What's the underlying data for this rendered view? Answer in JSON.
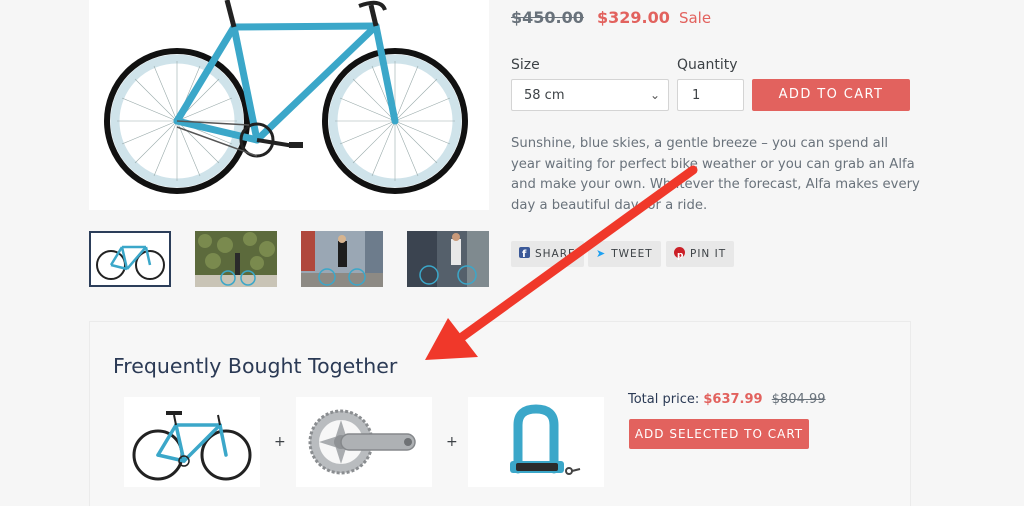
{
  "product": {
    "price_old": "$450.00",
    "price_new": "$329.00",
    "sale_label": "Sale"
  },
  "options": {
    "size_label": "Size",
    "size_value": "58 cm",
    "quantity_label": "Quantity",
    "quantity_value": "1",
    "add_to_cart": "ADD TO CART"
  },
  "description": "Sunshine, blue skies, a gentle breeze – you can spend all year waiting for perfect bike weather or you can grab an Alfa and make your own. Whatever the forecast, Alfa makes every day a beautiful day for a ride.",
  "share": {
    "facebook": "SHARE",
    "twitter": "TWEET",
    "pinterest": "PIN IT"
  },
  "fbt": {
    "title": "Frequently Bought Together",
    "plus": "+",
    "total_label": "Total price:",
    "total_new": "$637.99",
    "total_old": "$804.99",
    "add_selected": "ADD SELECTED TO CART"
  },
  "colors": {
    "accent": "#e2625e",
    "frame_blue": "#3ba7c9",
    "heading": "#2b3a55",
    "annotation_red": "#f0382a"
  }
}
